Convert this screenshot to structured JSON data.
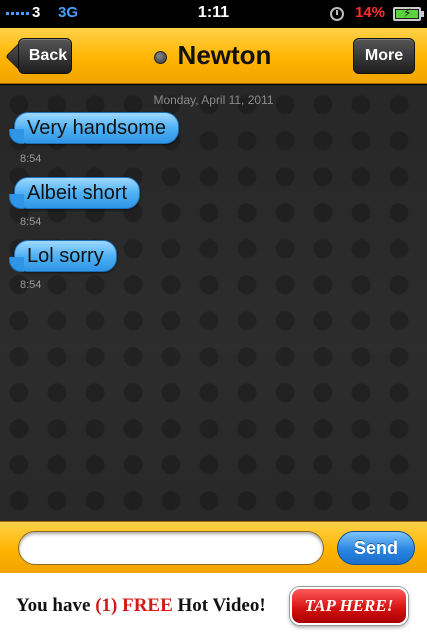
{
  "status_bar": {
    "carrier": "3",
    "network": "3G",
    "time": "1:11",
    "battery_percent": "14%",
    "battery_level": 0.14,
    "charging": true,
    "icons": [
      "signal-icon",
      "clock-icon",
      "battery-charging-icon"
    ]
  },
  "nav": {
    "back_label": "Back",
    "title": "Newton",
    "more_label": "More",
    "presence_icon": "offline-dot-icon"
  },
  "chat": {
    "date": "Monday, April 11, 2011",
    "messages": [
      {
        "text": "Very handsome",
        "time": "8:54"
      },
      {
        "text": "Albeit short",
        "time": "8:54"
      },
      {
        "text": "Lol sorry",
        "time": "8:54"
      }
    ]
  },
  "composer": {
    "input_value": "",
    "placeholder": "",
    "send_label": "Send"
  },
  "ad": {
    "text_before": "You have ",
    "highlight": "(1) FREE",
    "text_after": " Hot Video!",
    "cta_label": "TAP HERE!"
  },
  "colors": {
    "nav_yellow": "#ffb400",
    "bubble_blue": "#4fb1f5",
    "send_blue": "#2a86e0",
    "battery_red": "#ff2e2e",
    "ad_red": "#d21a1a"
  }
}
